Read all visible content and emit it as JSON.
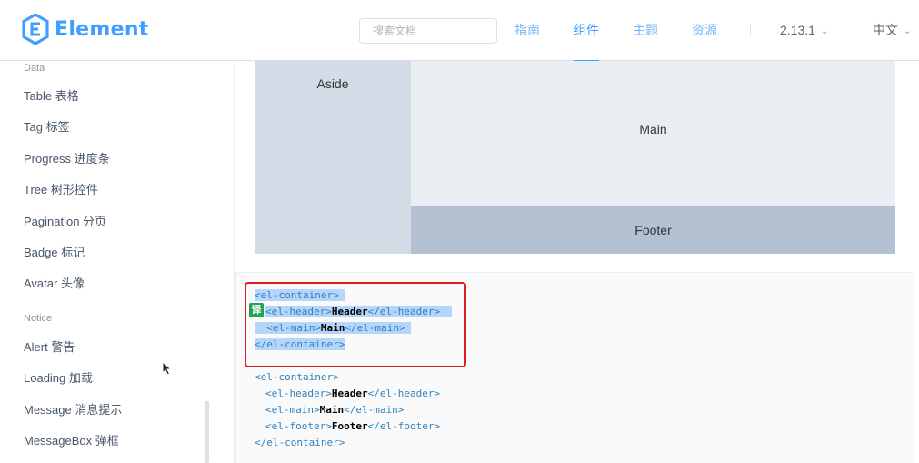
{
  "header": {
    "logo_text": "Element",
    "search_placeholder": "搜索文档",
    "nav": [
      "指南",
      "组件",
      "主题",
      "资源"
    ],
    "active_nav": "组件",
    "version": "2.13.1",
    "language": "中文"
  },
  "sidebar": {
    "groups": [
      {
        "title": "Data",
        "items": [
          "Table 表格",
          "Tag 标签",
          "Progress 进度条",
          "Tree 树形控件",
          "Pagination 分页",
          "Badge 标记",
          "Avatar 头像"
        ]
      },
      {
        "title": "Notice",
        "items": [
          "Alert 警告",
          "Loading 加载",
          "Message 消息提示",
          "MessageBox 弹框"
        ]
      }
    ]
  },
  "demo": {
    "aside": "Aside",
    "main": "Main",
    "footer": "Footer"
  },
  "code": {
    "open_container": "<el-container>",
    "close_container": "</el-container>",
    "header_open": "<el-header>",
    "header_close": "</el-header>",
    "header_text": "Header",
    "main_open": "<el-main>",
    "main_close": "</el-main>",
    "main_text": "Main",
    "footer_open": "<el-footer>",
    "footer_close": "</el-footer>",
    "footer_text": "Footer"
  },
  "translate_badge": "译",
  "colors": {
    "accent": "#409EFF",
    "aside_bg": "#d3dce6",
    "main_bg": "#e9eef3",
    "footer_bg": "#b3c0d1",
    "highlight_border": "#e02020",
    "selection_bg": "#b5d5fb",
    "code_tag": "#3182bd"
  },
  "icons": [
    "element-logo-icon",
    "chevron-down-icon",
    "mouse-cursor-icon"
  ]
}
